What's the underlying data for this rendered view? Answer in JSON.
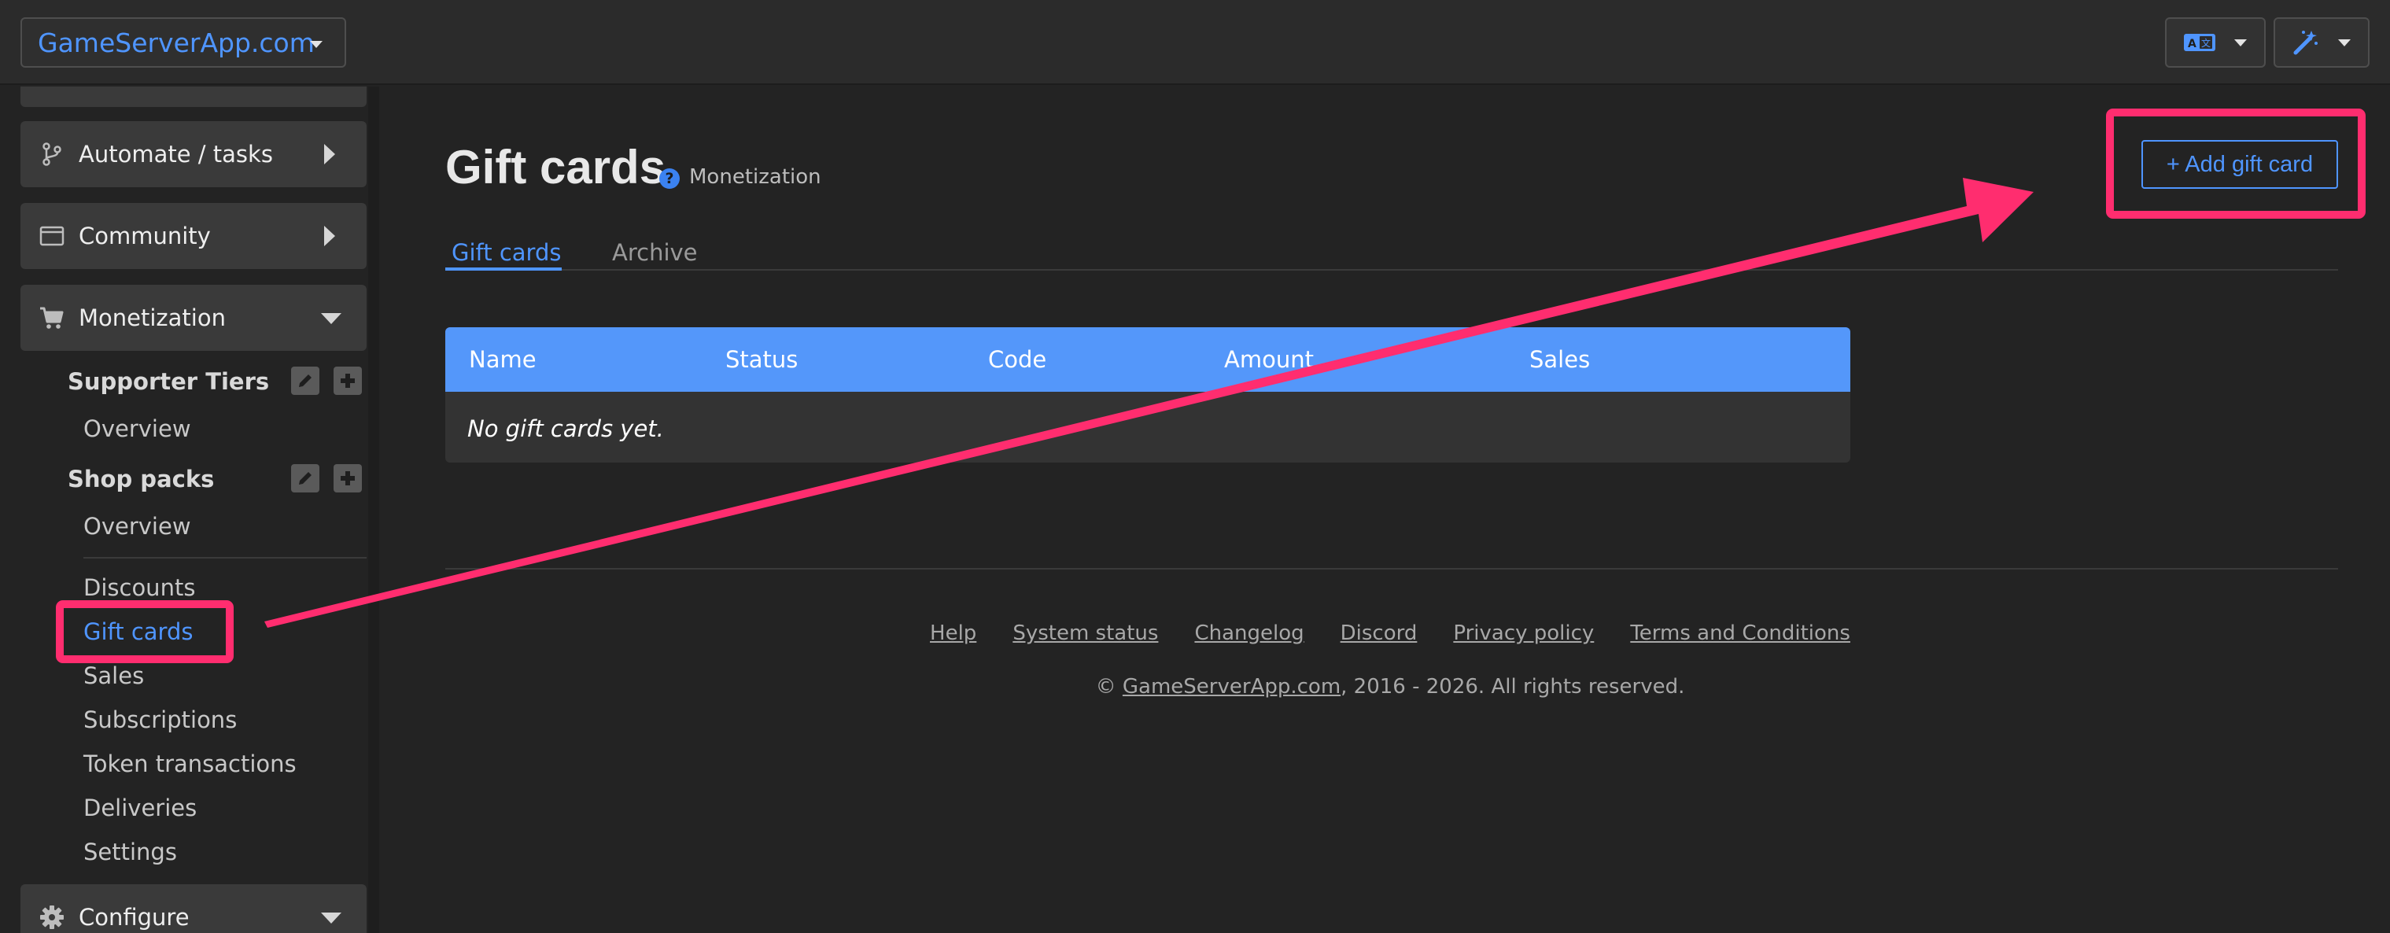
{
  "topbar": {
    "brand_label": "GameServerApp.com",
    "translate_icon": "translate-icon",
    "magic_icon": "magic-wand-icon"
  },
  "sidebar": {
    "panels": [
      {
        "label": "Automate / tasks",
        "icon": "branch-icon"
      },
      {
        "label": "Community",
        "icon": "window-icon"
      },
      {
        "label": "Monetization",
        "icon": "cart-icon"
      },
      {
        "label": "Configure",
        "icon": "gear-icon"
      }
    ],
    "supporter_tiers": {
      "heading": "Supporter Tiers",
      "overview": "Overview"
    },
    "shop_packs": {
      "heading": "Shop packs",
      "overview": "Overview"
    },
    "links": [
      "Discounts",
      "Gift cards",
      "Sales",
      "Subscriptions",
      "Token transactions",
      "Deliveries",
      "Settings"
    ],
    "active_link": "Gift cards"
  },
  "main": {
    "title": "Gift cards",
    "category": "Monetization",
    "add_button": "+ Add gift card",
    "tabs": [
      "Gift cards",
      "Archive"
    ],
    "table": {
      "columns": [
        "Name",
        "Status",
        "Code",
        "Amount",
        "Sales"
      ],
      "empty_text": "No gift cards yet."
    }
  },
  "footer": {
    "links": [
      "Help",
      "System status",
      "Changelog",
      "Discord",
      "Privacy policy",
      "Terms and Conditions"
    ],
    "copyright_prefix": "© ",
    "copyright_link": "GameServerApp.com",
    "copyright_suffix": ", 2016 - 2026. All rights reserved."
  },
  "colors": {
    "accent": "#4f95ff",
    "table_header": "#5497fa",
    "annotation": "#ff2d6f",
    "background": "#232323"
  }
}
